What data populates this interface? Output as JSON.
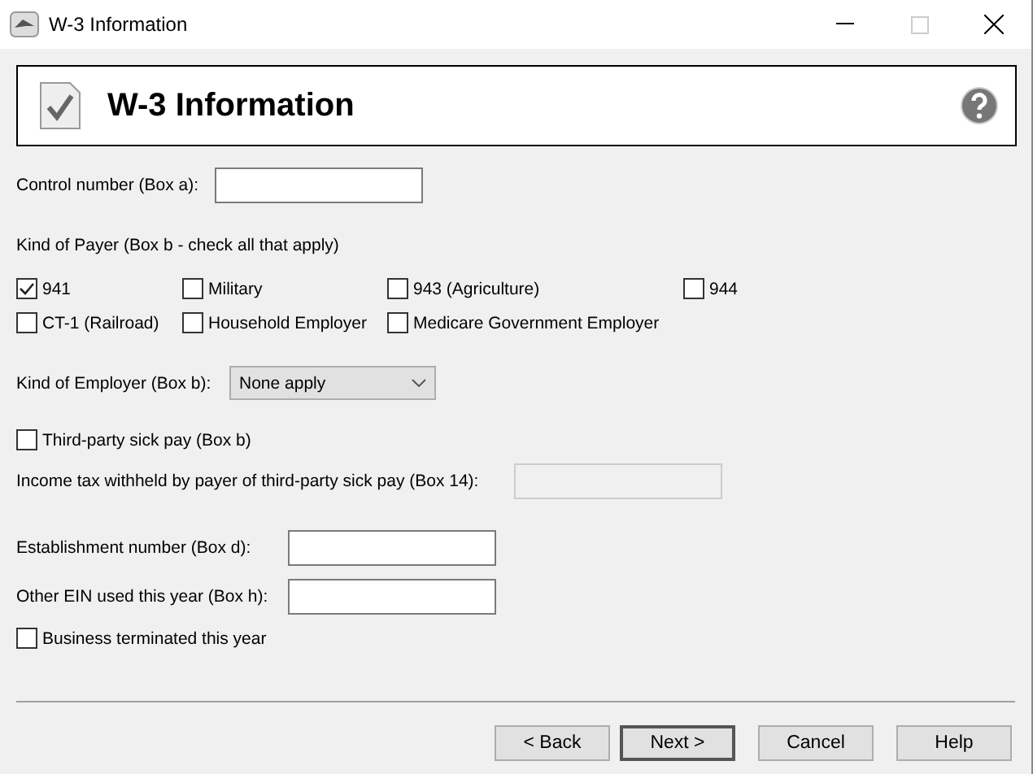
{
  "window": {
    "title": "W-3 Information"
  },
  "header": {
    "title": "W-3 Information"
  },
  "control_number": {
    "label": "Control number (Box a):"
  },
  "kind_of_payer": {
    "label": "Kind of Payer (Box b - check all that apply)",
    "options": [
      {
        "label": "941",
        "checked": true
      },
      {
        "label": "Military",
        "checked": false
      },
      {
        "label": "943 (Agriculture)",
        "checked": false
      },
      {
        "label": "944",
        "checked": false
      },
      {
        "label": "CT-1 (Railroad)",
        "checked": false
      },
      {
        "label": "Household Employer",
        "checked": false
      },
      {
        "label": "Medicare Government Employer",
        "checked": false
      }
    ]
  },
  "kind_of_employer": {
    "label": "Kind of Employer (Box b):",
    "value": "None apply"
  },
  "third_party_sick_pay": {
    "label": "Third-party sick pay (Box b)",
    "checked": false
  },
  "income_tax_withheld": {
    "label": "Income tax withheld by payer of third-party sick pay (Box 14):",
    "disabled": true
  },
  "establishment_number": {
    "label": "Establishment number (Box d):"
  },
  "other_ein": {
    "label": "Other EIN used this year (Box h):"
  },
  "business_terminated": {
    "label": "Business terminated this year",
    "checked": false
  },
  "buttons": [
    {
      "label": "< Back",
      "default": false
    },
    {
      "label": "Next >",
      "default": true
    },
    {
      "label": "Cancel",
      "default": false
    },
    {
      "label": "Help",
      "default": false
    }
  ]
}
